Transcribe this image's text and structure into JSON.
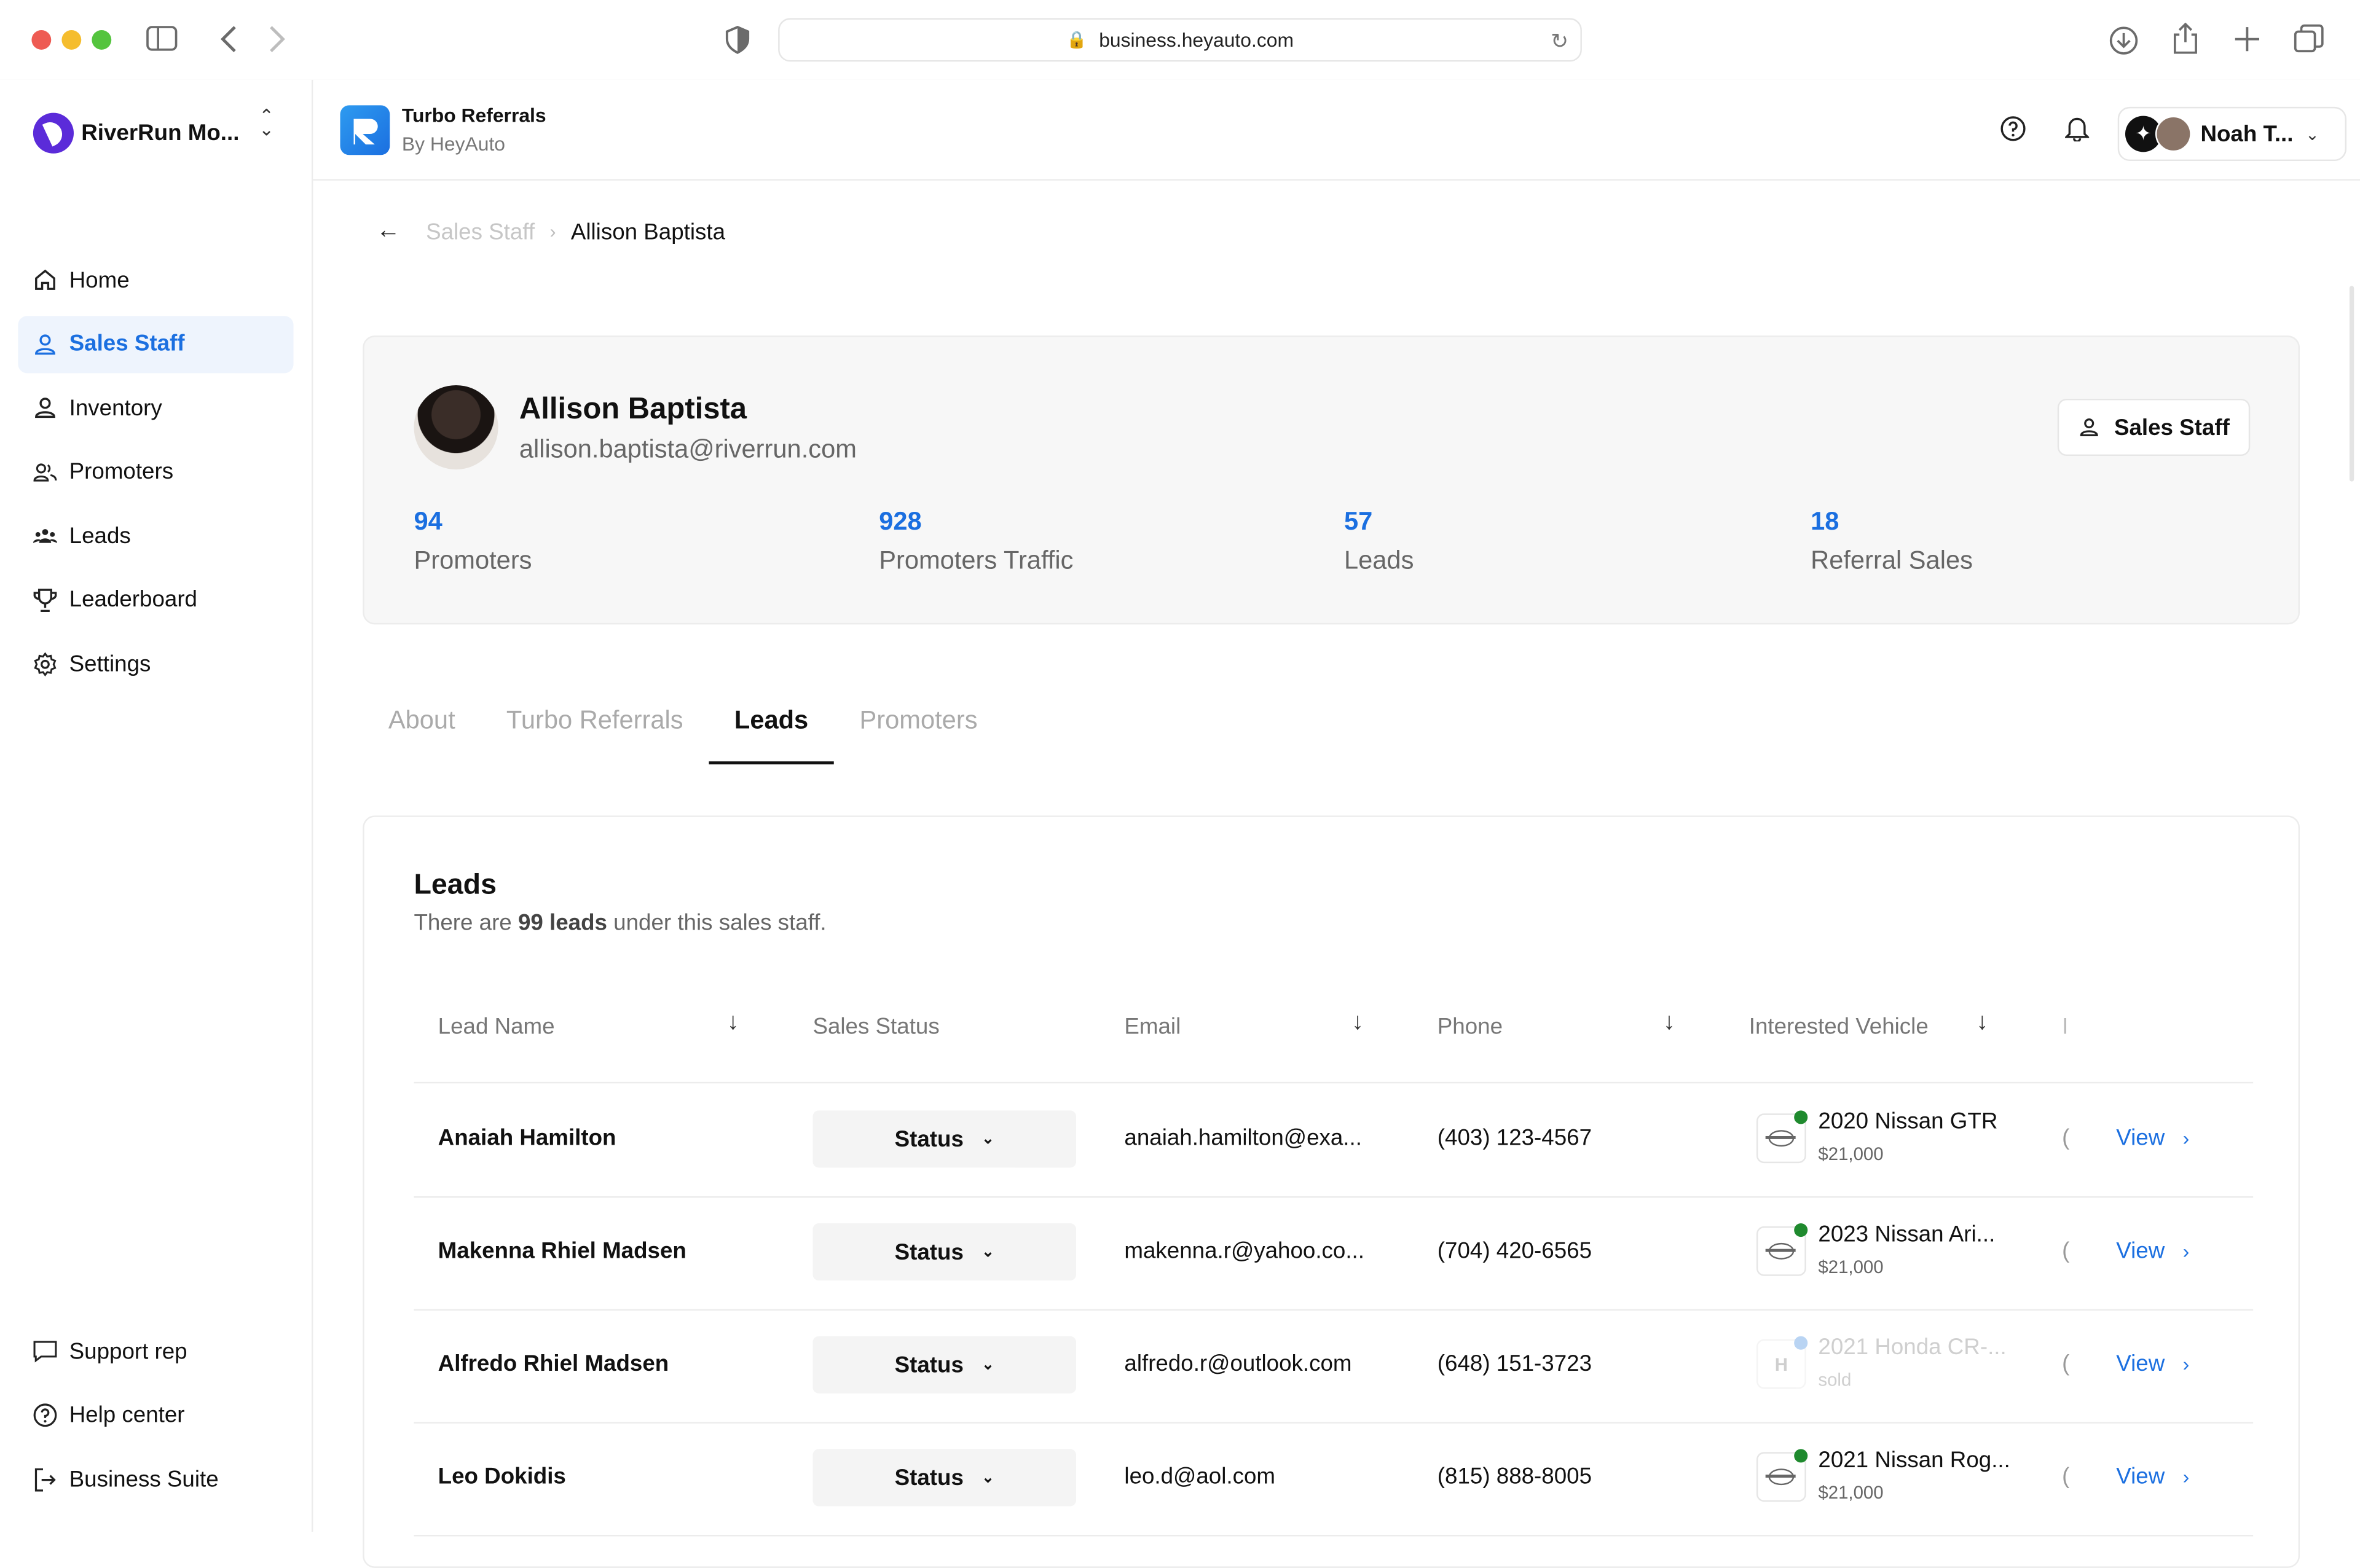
{
  "browser": {
    "url": "business.heyauto.com"
  },
  "sidebar": {
    "org_name": "RiverRun Mo...",
    "nav": [
      {
        "label": "Home",
        "icon": "home-icon",
        "active": false
      },
      {
        "label": "Sales Staff",
        "icon": "user-icon",
        "active": true
      },
      {
        "label": "Inventory",
        "icon": "user-icon",
        "active": false
      },
      {
        "label": "Promoters",
        "icon": "users-icon",
        "active": false
      },
      {
        "label": "Leads",
        "icon": "group-icon",
        "active": false
      },
      {
        "label": "Leaderboard",
        "icon": "trophy-icon",
        "active": false
      },
      {
        "label": "Settings",
        "icon": "gear-icon",
        "active": false
      }
    ],
    "bottom": [
      {
        "label": "Support rep",
        "icon": "chat-icon"
      },
      {
        "label": "Help center",
        "icon": "help-icon"
      },
      {
        "label": "Business Suite",
        "icon": "logout-icon"
      }
    ]
  },
  "header": {
    "app_title": "Turbo Referrals",
    "app_subtitle": "By HeyAuto",
    "user_name": "Noah T..."
  },
  "breadcrumb": {
    "parent": "Sales Staff",
    "current": "Allison Baptista"
  },
  "profile": {
    "name": "Allison Baptista",
    "email": "allison.baptista@riverrun.com",
    "role_button": "Sales Staff",
    "stats": [
      {
        "value": "94",
        "label": "Promoters"
      },
      {
        "value": "928",
        "label": "Promoters Traffic"
      },
      {
        "value": "57",
        "label": "Leads"
      },
      {
        "value": "18",
        "label": "Referral Sales"
      }
    ]
  },
  "tabs": [
    {
      "label": "About",
      "active": false
    },
    {
      "label": "Turbo Referrals",
      "active": false
    },
    {
      "label": "Leads",
      "active": true
    },
    {
      "label": "Promoters",
      "active": false
    }
  ],
  "leads": {
    "title": "Leads",
    "subtitle_pre": "There are ",
    "subtitle_count": "99 leads",
    "subtitle_post": " under this sales staff.",
    "columns": [
      "Lead Name",
      "Sales Status",
      "Email",
      "Phone",
      "Interested Vehicle",
      "I"
    ],
    "rows": [
      {
        "name": "Anaiah Hamilton",
        "status": "Status",
        "email": "anaiah.hamilton@exa...",
        "phone": "(403) 123-4567",
        "vehicle": "2020 Nissan GTR",
        "price": "$21,000",
        "dot_color": "#1f8a2e",
        "clip": "(",
        "action": "View",
        "dim": false
      },
      {
        "name": "Makenna Rhiel Madsen",
        "status": "Status",
        "email": "makenna.r@yahoo.co...",
        "phone": "(704) 420-6565",
        "vehicle": "2023 Nissan Ari...",
        "price": "$21,000",
        "dot_color": "#1f8a2e",
        "clip": "(",
        "action": "View",
        "dim": false
      },
      {
        "name": "Alfredo Rhiel Madsen",
        "status": "Status",
        "email": "alfredo.r@outlook.com",
        "phone": "(648) 151-3723",
        "vehicle": "2021 Honda CR-...",
        "price": "sold",
        "dot_color": "#b9d4f3",
        "clip": "(",
        "action": "View",
        "dim": true
      },
      {
        "name": "Leo Dokidis",
        "status": "Status",
        "email": "leo.d@aol.com",
        "phone": "(815) 888-8005",
        "vehicle": "2021 Nissan Rog...",
        "price": "$21,000",
        "dot_color": "#1f8a2e",
        "clip": "(",
        "action": "View",
        "dim": false
      }
    ]
  }
}
